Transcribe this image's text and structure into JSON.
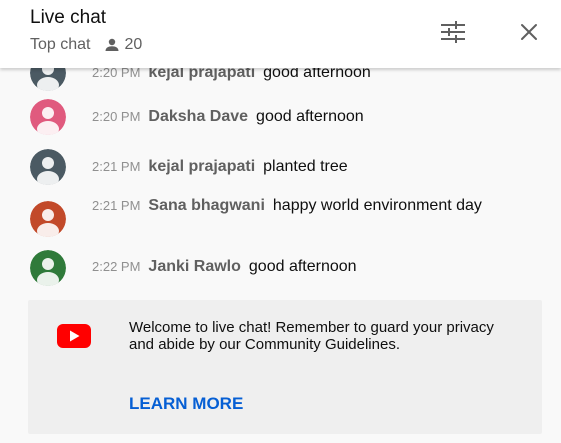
{
  "header": {
    "title": "Live chat",
    "mode": "Top chat",
    "viewer_count": "20"
  },
  "messages": [
    {
      "time": "2:20 PM",
      "author": "kejal prajapati",
      "text": "good afternoon",
      "avatar_color": "#4b5a63"
    },
    {
      "time": "2:20 PM",
      "author": "Daksha Dave",
      "text": "good afternoon",
      "avatar_color": "#e05a7e"
    },
    {
      "time": "2:21 PM",
      "author": "kejal prajapati",
      "text": "planted tree",
      "avatar_color": "#4b5a63"
    },
    {
      "time": "2:21 PM",
      "author": "Sana bhagwani",
      "text": "happy world environment day",
      "avatar_color": "#c24a2a"
    },
    {
      "time": "2:22 PM",
      "author": "Janki Rawlo",
      "text": "good afternoon",
      "avatar_color": "#2f7a3a"
    }
  ],
  "welcome": {
    "message": "Welcome to live chat! Remember to guard your privacy and abide by our Community Guidelines.",
    "link": "LEARN MORE"
  },
  "icons": {
    "viewers": "person-icon",
    "filter": "tune-icon",
    "close": "close-icon",
    "welcome_logo": "youtube-logo-icon"
  },
  "colors": {
    "link": "#065fd4",
    "youtube_red": "#ff0000"
  }
}
